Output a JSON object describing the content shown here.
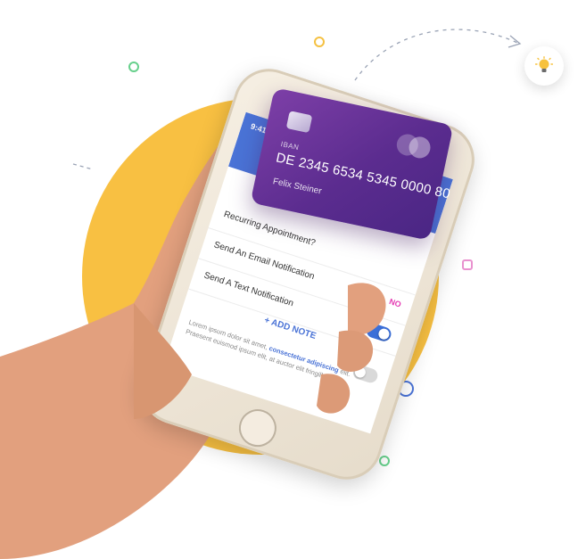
{
  "phone": {
    "status_time": "9:41",
    "status_icons": "••• ◔ ▬",
    "rows": [
      {
        "label": "Recurring Appointment?",
        "value": ""
      },
      {
        "label": "Send An Email Notification",
        "value": "NO"
      },
      {
        "label": "Send A Text Notification",
        "value": ""
      }
    ],
    "add_note": "+ ADD NOTE",
    "lorem_plain_1": "Lorem ipsum dolor sit amet, ",
    "lorem_link": "consectetur adipiscing",
    "lorem_plain_2": " elit. Praesent euismod ipsum elit, at auctor elit fringilla vitae."
  },
  "card": {
    "iban_label": "IBAN",
    "iban_number": "DE 2345 6534 5345 0000 80",
    "holder": "Felix Steiner"
  },
  "colors": {
    "accent_yellow": "#f8c042",
    "phone_blue": "#4a73d6",
    "card_purple": "#5b2c8f",
    "highlight_pink": "#e53bb3"
  },
  "icons": [
    "lightbulb-icon",
    "signal-icon",
    "wifi-icon",
    "battery-icon",
    "home-button-icon",
    "card-chip-icon",
    "card-network-logo-icon"
  ]
}
